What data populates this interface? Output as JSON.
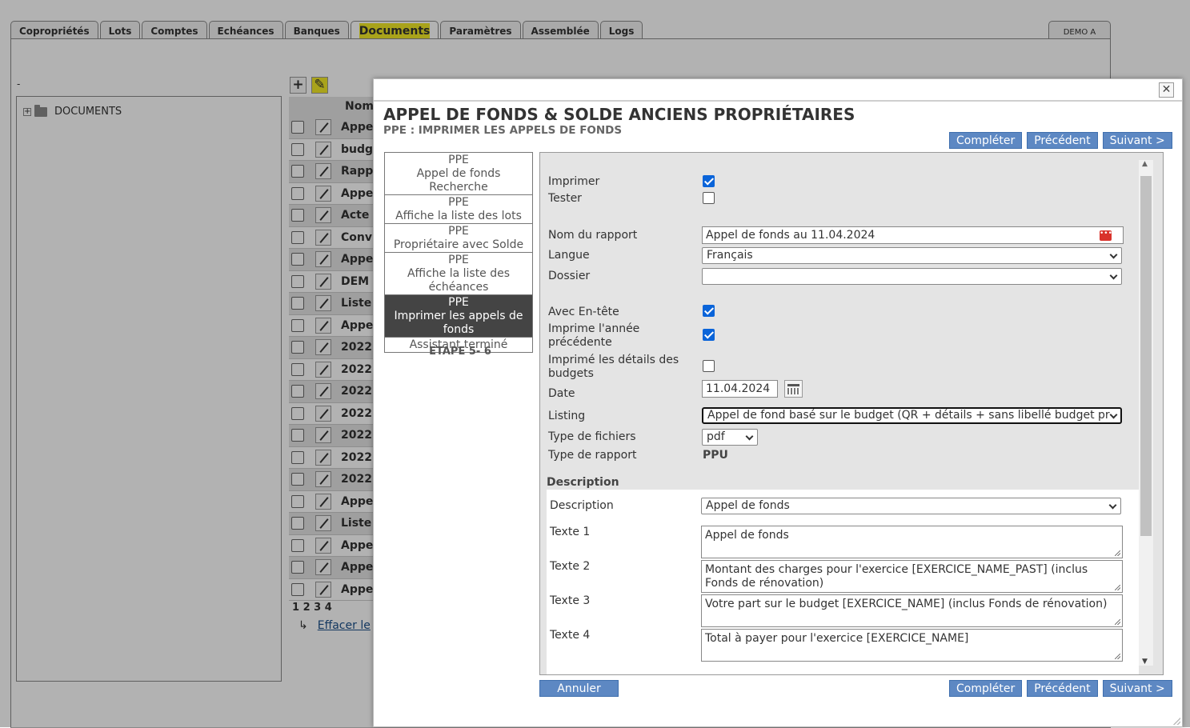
{
  "top_tabs": [
    {
      "label": "Copropriétés"
    },
    {
      "label": "Lots"
    },
    {
      "label": "Comptes"
    },
    {
      "label": "Echéances"
    },
    {
      "label": "Banques"
    },
    {
      "label": "Documents"
    },
    {
      "label": "Paramètres"
    },
    {
      "label": "Assemblée"
    },
    {
      "label": "Logs"
    }
  ],
  "user_tab": "DEMO A",
  "dash_mark": "-",
  "tree": {
    "root_label": "DOCUMENTS",
    "toggle": "+"
  },
  "toolbar": {
    "add_symbol": "+",
    "edit_symbol": "✎"
  },
  "doc_table": {
    "column_name": "Nom",
    "rows": [
      "Appe",
      "budg",
      "Rapp",
      "Appe",
      "Acte",
      "Conv",
      "Appe",
      "DEM",
      "Liste",
      "Appe",
      "2022",
      "2022",
      "2022",
      "2022",
      "2022",
      "2022",
      "2022",
      "Appe",
      "Liste",
      "Appe",
      "Appe",
      "Appe"
    ]
  },
  "pager": "1 2 3 4",
  "clear_link": {
    "arrow": "↳",
    "label": "Effacer le"
  },
  "dialog": {
    "close_symbol": "✕",
    "title": "APPEL DE FONDS & SOLDE ANCIENS PROPRIÉTAIRES",
    "subtitle": "PPE : IMPRIMER LES APPELS DE FONDS",
    "buttons": {
      "complete": "Compléter",
      "previous": "Précédent",
      "next": "Suivant >",
      "cancel": "Annuler"
    },
    "steps": [
      {
        "line1": "PPE",
        "line2": "Appel de fonds Recherche"
      },
      {
        "line1": "PPE",
        "line2": "Affiche la liste des lots"
      },
      {
        "line1": "PPE",
        "line2": "Propriétaire avec Solde"
      },
      {
        "line1": "PPE",
        "line2": "Affiche la liste des échéances"
      },
      {
        "line1": "PPE",
        "line2": "Imprimer les appels de fonds"
      },
      {
        "line1": "",
        "line2": "Assistant terminé"
      }
    ],
    "step_counter": "ETAPE  5- 6",
    "form": {
      "print_label": "Imprimer",
      "print_checked": true,
      "test_label": "Tester",
      "test_checked": false,
      "report_name_label": "Nom du rapport",
      "report_name_value": "Appel de fonds au 11.04.2024",
      "language_label": "Langue",
      "language_value": "Français",
      "folder_label": "Dossier",
      "folder_value": "",
      "header_label": "Avec En-tête",
      "header_checked": true,
      "prev_year_label": "Imprime l'année précédente",
      "prev_year_checked": true,
      "budget_details_label": "Imprimé les détails des budgets",
      "budget_details_checked": false,
      "date_label": "Date",
      "date_value": "11.04.2024",
      "listing_label": "Listing",
      "listing_value": "Appel de fond basé sur le budget (QR + détails + sans libellé budget pr",
      "file_type_label": "Type de fichiers",
      "file_type_value": "pdf",
      "report_type_label": "Type de rapport",
      "report_type_value": "PPU"
    },
    "description": {
      "section_title": "Description",
      "select_label": "Description",
      "select_value": "Appel de fonds",
      "texts": [
        {
          "label": "Texte 1",
          "value": "Appel de fonds"
        },
        {
          "label": "Texte 2",
          "value": "Montant des charges pour l'exercice [EXERCICE_NAME_PAST] (inclus Fonds de rénovation)"
        },
        {
          "label": "Texte 3",
          "value": "Votre part sur le budget [EXERCICE_NAME] (inclus Fonds de rénovation)"
        },
        {
          "label": "Texte 4",
          "value": "Total à payer pour l'exercice [EXERCICE_NAME]"
        }
      ]
    }
  }
}
